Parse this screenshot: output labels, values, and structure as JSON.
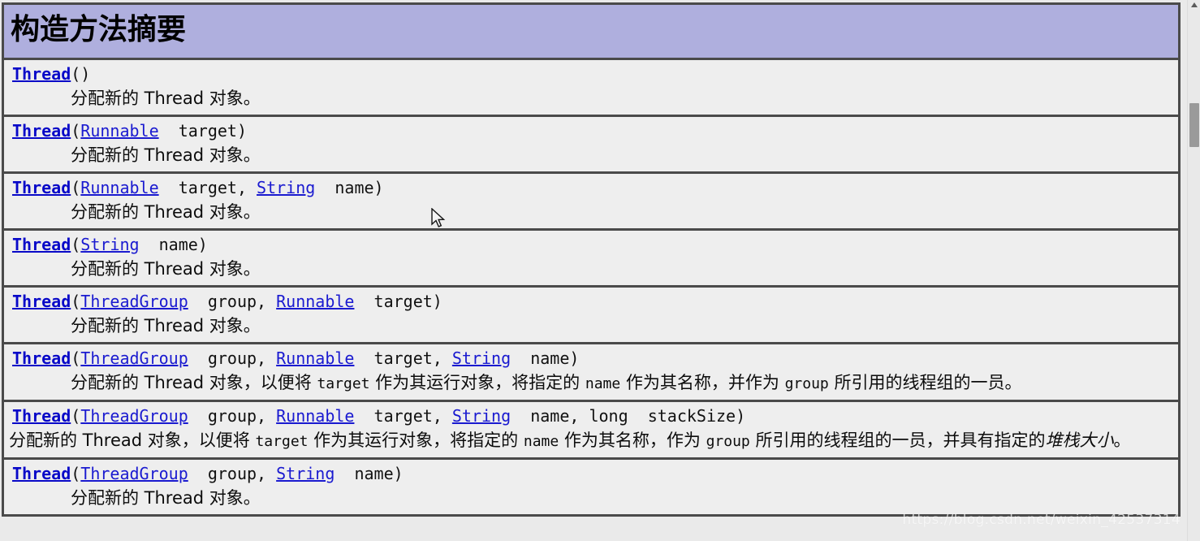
{
  "page": {
    "header_title": "构造方法摘要",
    "header_bg": "#afafde",
    "row_bg": "#eeeeee",
    "border_color": "#4a4a4a",
    "link_color": "#0808c8"
  },
  "constructors": [
    {
      "sig_name": "Thread",
      "sig_parts": [
        {
          "text": "(",
          "kind": "plain"
        },
        {
          "text": ")",
          "kind": "plain"
        }
      ],
      "signature_text": "Thread()",
      "description": "分配新的 Thread 对象。"
    },
    {
      "sig_name": "Thread",
      "signature_text": "Thread(Runnable  target)",
      "description": "分配新的 Thread 对象。"
    },
    {
      "sig_name": "Thread",
      "signature_text": "Thread(Runnable  target, String  name)",
      "description": "分配新的 Thread 对象。"
    },
    {
      "sig_name": "Thread",
      "signature_text": "Thread(String  name)",
      "description": "分配新的 Thread 对象。"
    },
    {
      "sig_name": "Thread",
      "signature_text": "Thread(ThreadGroup  group, Runnable  target)",
      "description": "分配新的 Thread 对象。"
    },
    {
      "sig_name": "Thread",
      "signature_text": "Thread(ThreadGroup  group, Runnable  target, String  name)",
      "description": "分配新的 Thread 对象，以便将 target 作为其运行对象，将指定的 name 作为其名称，并作为 group 所引用的线程组的一员。"
    },
    {
      "sig_name": "Thread",
      "signature_text": "Thread(ThreadGroup  group, Runnable  target, String  name, long  stackSize)",
      "description": "分配新的 Thread 对象，以便将 target 作为其运行对象，将指定的 name 作为其名称，作为 group 所引用的线程组的一员，并具有指定的堆栈大小。"
    },
    {
      "sig_name": "Thread",
      "signature_text": "Thread(ThreadGroup  group, String  name)",
      "description": "分配新的 Thread 对象。"
    }
  ],
  "text": {
    "thread": "Thread",
    "open_paren": "(",
    "close_paren": ")",
    "runnable": "Runnable",
    "string": "String",
    "threadgroup": "ThreadGroup",
    "target": "  target",
    "target_comma": "  target, ",
    "name": "  name",
    "name_comma": "  name, ",
    "group_comma": "  group, ",
    "long_stacksize": "long  stackSize",
    "long_kw": "long",
    "stacksize": "stackSize",
    "desc_simple": "分配新的 Thread 对象。",
    "d6_a": "分配新的 Thread 对象，以便将 ",
    "d6_target": "target",
    "d6_b": " 作为其运行对象，将指定的 ",
    "d6_name": "name",
    "d6_c": " 作为其名称，并作为 ",
    "d6_group": "group",
    "d6_d": " 所引用的线程组的一员。",
    "d7_a": "分配新的 Thread 对象，以便将 ",
    "d7_target": "target",
    "d7_b": " 作为其运行对象，将指定的 ",
    "d7_name": "name",
    "d7_c": " 作为其名称，作为 ",
    "d7_group": "group",
    "d7_d": " 所引用的线程组的一员，并具有指定的",
    "d7_italic": "堆栈大小",
    "d7_e": "。"
  },
  "watermark": {
    "url": "https://blog.csdn.net/weixin_42537314"
  },
  "scrollbar": {
    "position_percent": 19
  }
}
